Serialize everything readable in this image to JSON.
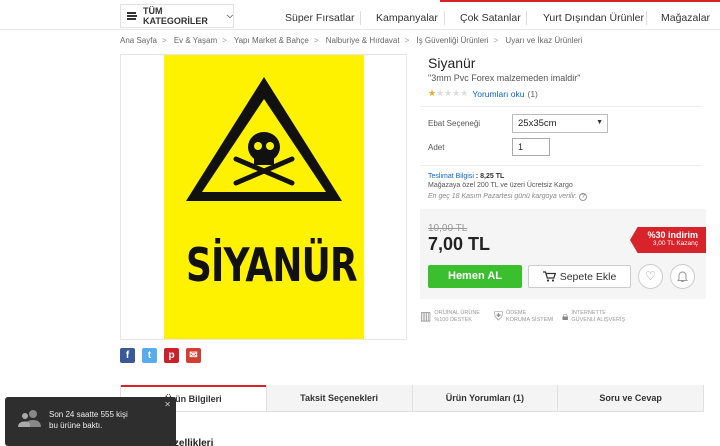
{
  "header": {
    "all_categories": "TÜM KATEGORİLER",
    "nav": [
      "Süper Fırsatlar",
      "Kampanyalar",
      "Çok Satanlar",
      "Yurt Dışından Ürünler",
      "Mağazalar"
    ]
  },
  "breadcrumb": [
    "Ana Sayfa",
    "Ev & Yaşam",
    "Yapı Market & Bahçe",
    "Nalburiye & Hırdavat",
    "İş Güvenliği Ürünleri",
    "Uyarı ve İkaz Ürünleri"
  ],
  "product": {
    "sign_text": "SİYANÜR",
    "title": "Siyanür",
    "subtitle": "\"3mm Pvc Forex malzemeden imaldir\"",
    "rating": 1,
    "reviews_link": "Yorumları oku",
    "reviews_count": "(1)",
    "size_label": "Ebat Seçeneği",
    "size_value": "25x35cm",
    "qty_label": "Adet",
    "qty_value": "1"
  },
  "shipping": {
    "label": "Teslimat Bilgisi",
    "price": ": 8,25 TL",
    "free_note": "Mağazaya özel 200 TL ve üzeri Ücretsiz Kargo",
    "date_note": "En geç 18 Kasım Pazartesi günü kargoya verilir."
  },
  "pricing": {
    "old_price": "10,00 TL",
    "price": "7,00 TL",
    "discount_pct": "%30 indirim",
    "discount_saving": "3,00 TL Kazanç",
    "buy_now": "Hemen AL",
    "add_to_cart": "Sepete Ekle"
  },
  "badges": [
    {
      "line1": "ORİJİNAL ÜRÜNE",
      "line2": "%100 DESTEK"
    },
    {
      "line1": "ÖDEME",
      "line2": "KORUMA SİSTEMİ"
    },
    {
      "line1": "İNTERNETTE",
      "line2": "GÜVENLİ ALIŞVERİŞ"
    }
  ],
  "social": [
    "f",
    "t",
    "p",
    "✉"
  ],
  "colors": {
    "brand_red": "#d8232a",
    "buy_green": "#3cbf2f",
    "sign_yellow": "#fff200",
    "link_blue": "#0b63c5"
  },
  "tabs": [
    "Ürün Bilgileri",
    "Taksit Seçenekleri",
    "Ürün Yorumları (1)",
    "Soru ve Cevap"
  ],
  "content_title": "Ürün Özellikleri",
  "toast": {
    "line1": "Son 24 saatte 555 kişi",
    "line2": "bu ürüne baktı."
  }
}
